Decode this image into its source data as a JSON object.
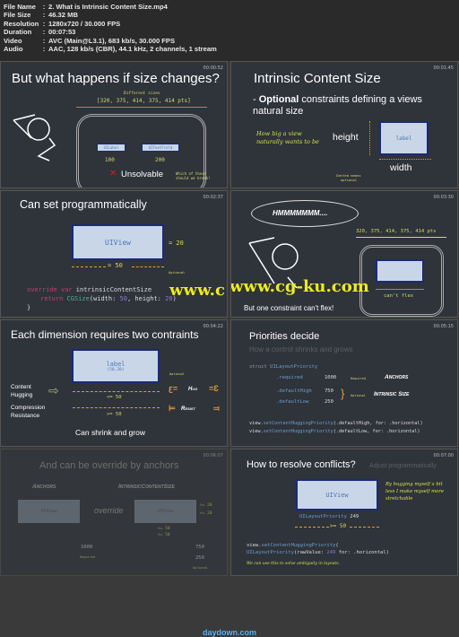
{
  "file_info": [
    {
      "key": "File Name",
      "value": "2. What is Intrinsic Content Size.mp4"
    },
    {
      "key": "File Size",
      "value": "46.32 MB"
    },
    {
      "key": "Resolution",
      "value": "1280x720 / 30.000 FPS"
    },
    {
      "key": "Duration",
      "value": "00:07:53"
    },
    {
      "key": "Video",
      "value": "AVC (Main@L3.1), 683 kb/s, 30.000 FPS"
    },
    {
      "key": "Audio",
      "value": "AAC, 128 kb/s (CBR), 44.1 kHz, 2 channels, 1 stream"
    }
  ],
  "separator": ":",
  "frames": [
    {
      "timestamp": "00:00:52",
      "title": "But what happens if size changes?",
      "sizes_label": "Different sizes",
      "sizes": "[320, 375, 414, 375, 414 pts]",
      "label_box": "UILabel",
      "field_box": "UITextField",
      "w1": "100",
      "w2": "200",
      "unsolvable": "Unsolvable",
      "note": "Which of these should we break!"
    },
    {
      "timestamp": "00:01:45",
      "title": "Intrinsic Content Size",
      "bullet_bold": "Optional",
      "bullet_rest": " constraints defining a views natural size",
      "hand": "How big a view naturally wants to be",
      "height": "height",
      "width": "width",
      "box": "label",
      "dotted": "Dotted means optional"
    },
    {
      "timestamp": "00:02:37",
      "title": "Can set programmatically",
      "box": "UIView",
      "h": "= 20",
      "w": "= 50",
      "optional": "Optional",
      "code1a": "override var",
      "code1b": " intrinsicContentSize",
      "code2a": "return",
      "code2b": " CGSize",
      "code2c": "(width: ",
      "code2d": "50",
      "code2e": ", height: ",
      "code2f": "20",
      "code2g": ")",
      "code3": "}"
    },
    {
      "timestamp": "00:03:30",
      "thought": "HMMMMMMM....",
      "sizes": "320, 375, 414, 375, 414 pts",
      "cant": "can't flex",
      "caption": "But one constraint can't flex!"
    },
    {
      "timestamp": "00:04:22",
      "title": "Each dimension requires two contraints",
      "box": "label",
      "box_sub": "(50,20)",
      "hug_label": "Content Hugging",
      "res_label": "Compression Resistance",
      "le": "<= 50",
      "ge": ">= 50",
      "optional": "Optional",
      "hug": "Hug",
      "resist": "Resist",
      "caption": "Can shrink and grow"
    },
    {
      "timestamp": "00:05:15",
      "title": "Priorities decide",
      "subtitle": "How a control shrinks and grows",
      "struct_kw": "struct",
      "struct_name": " UILayoutPriority",
      "rows": [
        {
          "name": ".required",
          "value": "1000"
        },
        {
          "name": ".defaultHigh",
          "value": "750"
        },
        {
          "name": ".defaultLow",
          "value": "250"
        }
      ],
      "required": "Required",
      "optional": "Optional",
      "anchors": "Anchors",
      "intrinsic": "Intrinsic Size",
      "line1a": "view.",
      "line1b": "setContentHuggingPriority",
      "line1c": "(.defaultHigh, for: .horizontal)",
      "line2a": "view.",
      "line2b": "setContentHuggingPriority",
      "line2c": "(.defaultLow, for: .horizontal)"
    },
    {
      "timestamp": "00:06:07",
      "title": "And can be override by anchors",
      "anchors": "Anchors",
      "intrinsic": "IntrinsicContentSize",
      "box1": "UIView",
      "box2": "UIView",
      "override": "override",
      "v1": "1000",
      "v2": "750",
      "v3": "250",
      "required": "Required",
      "optional": "Optional",
      "eq1": ">= 20",
      "eq2": "<= 20",
      "w1": "<= 50",
      "w2": ">= 50"
    },
    {
      "timestamp": "00:07:00",
      "title": "How to resolve conflicts?",
      "subtitle": "Adjust programmatically",
      "box": "UIView",
      "prio_name": "UILayoutPriority",
      "prio_val": " 249",
      "w": ">= 50",
      "hand": "By hugging myself a bit less I make myself more stretchable",
      "code1a": "view.",
      "code1b": "setContentHuggingPriority",
      "code1c": "(",
      "code2a": "UILayoutPriority",
      "code2b": "(rawValue: ",
      "code2c": "249",
      "code2d": " for: .horizontal)",
      "note": "We can use this to solve ambiguity in layouts."
    }
  ],
  "watermarks": {
    "cgku": "www.cg-ku.com",
    "daydown": "daydown.com"
  },
  "colors": {
    "panel_bg": "#2f333a",
    "box_fill": "#c9d6e8",
    "box_border": "#1b2a7a",
    "accent_yellow": "#d4d96a",
    "accent_orange": "#e39a3a"
  }
}
